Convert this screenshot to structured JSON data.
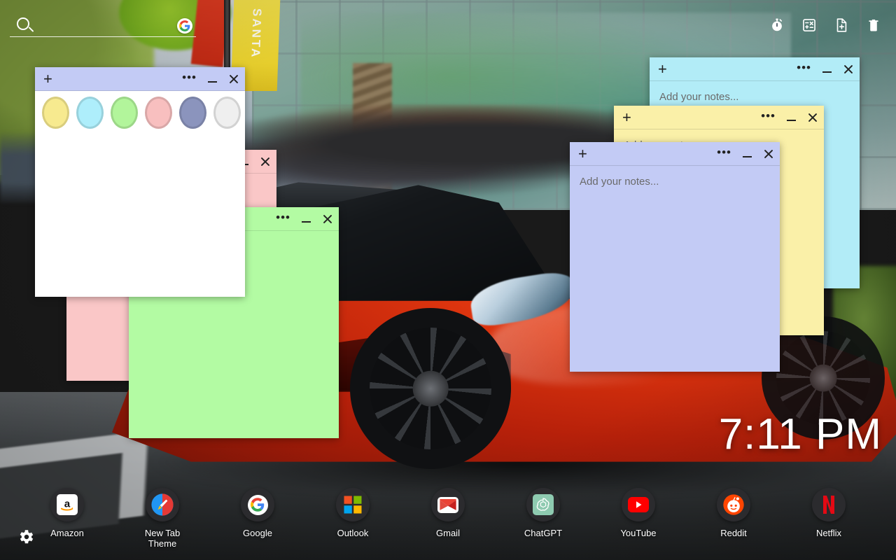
{
  "search": {
    "placeholder": "",
    "value": "",
    "icon": "search-icon",
    "engine_icon": "google-g-icon"
  },
  "topbar": {
    "icons": [
      {
        "name": "stopwatch-icon",
        "label": "Timer"
      },
      {
        "name": "calculator-icon",
        "label": "Calculator"
      },
      {
        "name": "new-note-icon",
        "label": "New Note"
      },
      {
        "name": "trash-icon",
        "label": "Trash"
      }
    ]
  },
  "clock": {
    "time": "7:11 PM"
  },
  "notes": {
    "placeholder": "Add your notes...",
    "plus_label": "+",
    "dots_label": "•••",
    "windows": [
      {
        "id": "note-cyan",
        "color": "#b2ecf7",
        "titlebar": "#b2ecf7",
        "placeholder": "Add your notes...",
        "has_text": true
      },
      {
        "id": "note-yellow",
        "color": "#faf0a8",
        "titlebar": "#faf0a8",
        "placeholder": "Add your notes...",
        "has_text": true
      },
      {
        "id": "note-purple",
        "color": "#c3cbf5",
        "titlebar": "#c3cbf5",
        "placeholder": "Add your notes...",
        "has_text": true
      },
      {
        "id": "note-pink",
        "color": "#fac7c7",
        "titlebar": "#fac7c7",
        "placeholder": "",
        "has_text": false
      },
      {
        "id": "note-green",
        "color": "#b3fba3",
        "titlebar": "#b3fba3",
        "placeholder": "",
        "has_text": false
      },
      {
        "id": "note-palette",
        "color": "#ffffff",
        "titlebar": "#c3cbf5",
        "placeholder": "",
        "has_text": false
      }
    ]
  },
  "palette": {
    "colors": [
      {
        "name": "swatch-yellow",
        "hex": "#f7ea8f",
        "selected": false
      },
      {
        "name": "swatch-cyan",
        "hex": "#aeeefb",
        "selected": false
      },
      {
        "name": "swatch-green",
        "hex": "#b2f59b",
        "selected": false
      },
      {
        "name": "swatch-pink",
        "hex": "#f8bfbf",
        "selected": false
      },
      {
        "name": "swatch-purple",
        "hex": "#8b94bd",
        "selected": true
      },
      {
        "name": "swatch-white",
        "hex": "#efefef",
        "selected": false
      }
    ]
  },
  "dock": {
    "items": [
      {
        "name": "amazon",
        "label": "Amazon",
        "icon": "amazon-icon"
      },
      {
        "name": "new-tab-theme",
        "label": "New Tab Theme",
        "icon": "paintbrush-icon"
      },
      {
        "name": "google",
        "label": "Google",
        "icon": "google-g-icon"
      },
      {
        "name": "outlook",
        "label": "Outlook",
        "icon": "microsoft-icon"
      },
      {
        "name": "gmail",
        "label": "Gmail",
        "icon": "gmail-icon"
      },
      {
        "name": "chatgpt",
        "label": "ChatGPT",
        "icon": "openai-icon"
      },
      {
        "name": "youtube",
        "label": "YouTube",
        "icon": "youtube-icon"
      },
      {
        "name": "reddit",
        "label": "Reddit",
        "icon": "reddit-icon"
      },
      {
        "name": "netflix",
        "label": "Netflix",
        "icon": "netflix-icon"
      }
    ]
  },
  "settings": {
    "icon": "gear-icon",
    "label": "Settings"
  },
  "wallpaper": {
    "banner_text": "SANTA"
  },
  "colors": {
    "cyan": "#b2ecf7",
    "yellow": "#faf0a8",
    "purple": "#c3cbf5",
    "pink": "#fac7c7",
    "green": "#b3fba3",
    "white": "#ffffff"
  }
}
